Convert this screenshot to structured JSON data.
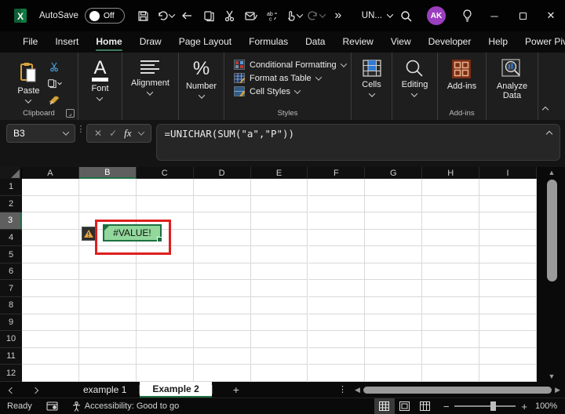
{
  "titlebar": {
    "autosave_label": "AutoSave",
    "autosave_state": "Off",
    "doc_title": "UN...",
    "avatar_initials": "AK",
    "more_commands": "»"
  },
  "menubar": {
    "items": [
      "File",
      "Insert",
      "Home",
      "Draw",
      "Page Layout",
      "Formulas",
      "Data",
      "Review",
      "View",
      "Developer",
      "Help",
      "Power Pivot"
    ],
    "active": "Home"
  },
  "ribbon": {
    "paste_label": "Paste",
    "clipboard_group": "Clipboard",
    "font_label": "Font",
    "alignment_label": "Alignment",
    "number_label": "Number",
    "styles_buttons": [
      "Conditional Formatting",
      "Format as Table",
      "Cell Styles"
    ],
    "styles_group": "Styles",
    "cells_label": "Cells",
    "editing_label": "Editing",
    "addins_label": "Add-ins",
    "addins_group": "Add-ins",
    "analyze_label_1": "Analyze",
    "analyze_label_2": "Data"
  },
  "formula_bar": {
    "name_box": "B3",
    "fx_label": "fx",
    "formula": "=UNICHAR(SUM(\"a\",\"P\"))"
  },
  "grid": {
    "columns": [
      "A",
      "B",
      "C",
      "D",
      "E",
      "F",
      "G",
      "H",
      "I"
    ],
    "rows": [
      "1",
      "2",
      "3",
      "4",
      "5",
      "6",
      "7",
      "8",
      "9",
      "10",
      "11",
      "12"
    ],
    "selected_column": "B",
    "selected_row": "3",
    "cell_value": "#VALUE!",
    "cell_fill": "#92d89c",
    "selection_border": "#1d6f42",
    "annotation_color": "#dd1f1f"
  },
  "sheet_tabs": {
    "tabs": [
      {
        "label": "example 1",
        "active": false
      },
      {
        "label": "Example 2",
        "active": true
      }
    ]
  },
  "status_bar": {
    "ready": "Ready",
    "accessibility": "Accessibility: Good to go",
    "zoom": "100%"
  },
  "colors": {
    "accent_green": "#169150",
    "selection_green": "#1d6f42",
    "avatar_purple": "#9c3ec0",
    "error_fill": "#92d89c",
    "annotation_red": "#dd1f1f"
  }
}
